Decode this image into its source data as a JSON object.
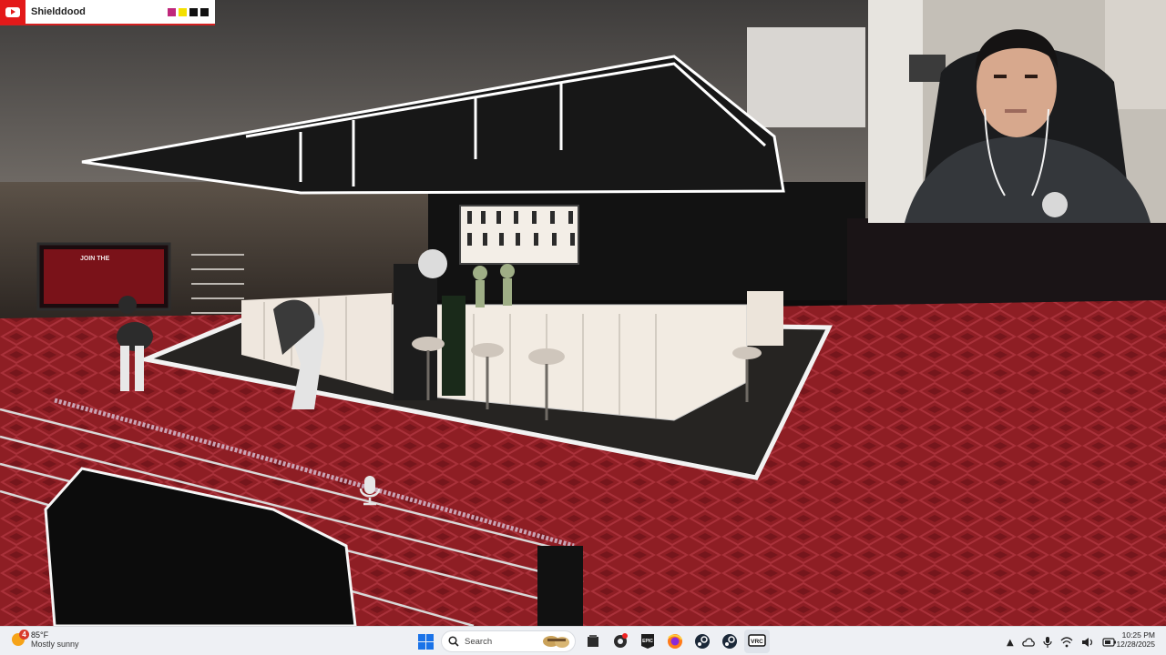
{
  "stream_overlay": {
    "channel_name": "Shielddood",
    "swatch_colors": [
      "#c0277b",
      "#f4e000",
      "#111111",
      "#111111"
    ],
    "icons": [
      "youtube-icon",
      "microphone-icon"
    ]
  },
  "scene": {
    "poster_text": "JOIN THE"
  },
  "taskbar": {
    "weather": {
      "temp": "85°F",
      "desc": "Mostly sunny",
      "badge": "4"
    },
    "search_placeholder": "Search",
    "pinned": [
      "windows-start",
      "search",
      "file-explorer",
      "chatgpt",
      "epic-games",
      "firefox",
      "steam",
      "steam-2",
      "vrchat"
    ],
    "vrc_label": "VRC",
    "epic_label": "EPIC",
    "clock": {
      "time": "10:25 PM",
      "date": "12/28/2025"
    }
  }
}
